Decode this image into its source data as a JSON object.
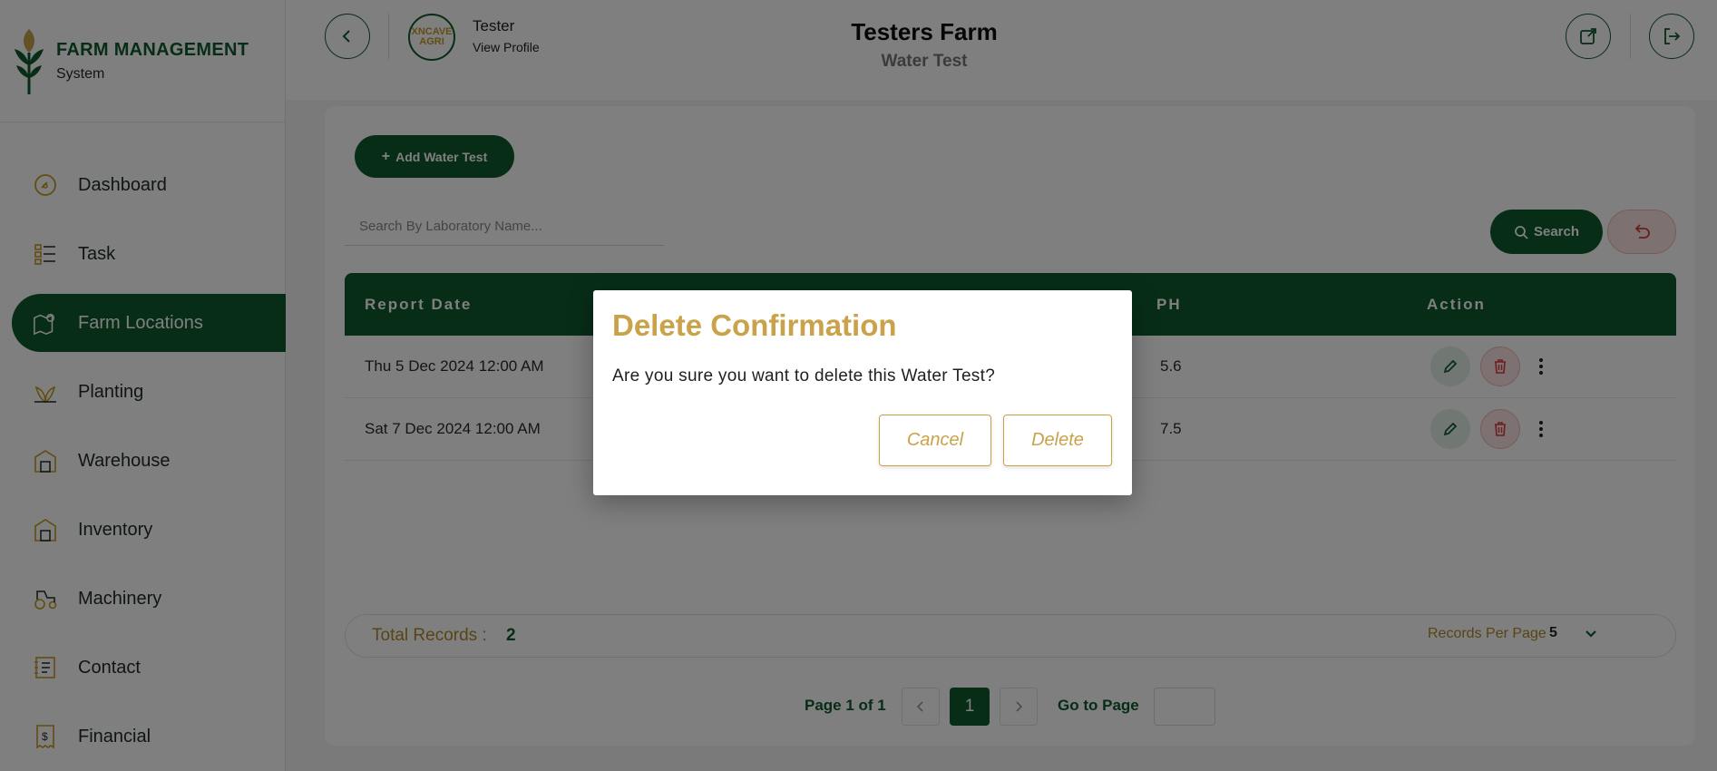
{
  "brand": {
    "title": "FARM MANAGEMENT",
    "subtitle": "System"
  },
  "sidebar": {
    "items": [
      {
        "label": "Dashboard",
        "icon": "dashboard-icon",
        "active": false
      },
      {
        "label": "Task",
        "icon": "task-list-icon",
        "active": false
      },
      {
        "label": "Farm Locations",
        "icon": "map-pin-icon",
        "active": true
      },
      {
        "label": "Planting",
        "icon": "plant-icon",
        "active": false
      },
      {
        "label": "Warehouse",
        "icon": "warehouse-icon",
        "active": false
      },
      {
        "label": "Inventory",
        "icon": "inventory-icon",
        "active": false
      },
      {
        "label": "Machinery",
        "icon": "tractor-icon",
        "active": false
      },
      {
        "label": "Contact",
        "icon": "contact-card-icon",
        "active": false
      },
      {
        "label": "Financial",
        "icon": "receipt-dollar-icon",
        "active": false
      }
    ]
  },
  "header": {
    "user_name": "Tester",
    "view_profile": "View Profile",
    "avatar_text": "XNCAVE AGRI",
    "farm_title": "Testers Farm",
    "page_subtitle": "Water Test"
  },
  "toolbar": {
    "add_button": "Add Water Test",
    "search_placeholder": "Search By Laboratory Name...",
    "search_button": "Search"
  },
  "table": {
    "columns": [
      "Report Date",
      "PH",
      "Action"
    ],
    "rows": [
      {
        "report_date": "Thu 5 Dec 2024 12:00 AM",
        "ph": "5.6"
      },
      {
        "report_date": "Sat 7 Dec 2024 12:00 AM",
        "ph": "7.5"
      }
    ]
  },
  "footer": {
    "total_label": "Total Records :",
    "total_value": "2",
    "records_per_page_label": "Records Per Page",
    "records_per_page_value": "5"
  },
  "pagination": {
    "page_label": "Page 1 of 1",
    "current_page": "1",
    "goto_label": "Go to Page"
  },
  "modal": {
    "title": "Delete Confirmation",
    "message": "Are you sure you want to delete this Water Test?",
    "cancel": "Cancel",
    "delete": "Delete"
  },
  "colors": {
    "brand_green": "#0f5a2e",
    "gold": "#c9a24a",
    "danger_bg": "#fbe3e3"
  }
}
